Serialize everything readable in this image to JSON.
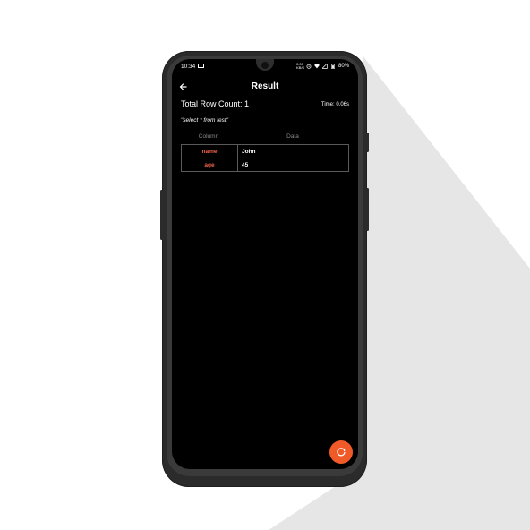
{
  "status_bar": {
    "time": "10:34",
    "speed_top": "0.00",
    "speed_bottom": "KB/S",
    "battery": "80%"
  },
  "header": {
    "title": "Result"
  },
  "summary": {
    "row_count": "Total Row Count: 1",
    "time": "Time: 0.06s",
    "query": "\"select * from test\""
  },
  "table": {
    "col_header": "Column",
    "data_header": "Data",
    "rows": [
      {
        "key": "name",
        "value": "John"
      },
      {
        "key": "age",
        "value": "45"
      }
    ]
  },
  "colors": {
    "accent": "#f05a28",
    "key_text": "#f0634a",
    "screen_bg": "#000000"
  },
  "icons": {
    "back": "arrow-left-icon",
    "refresh": "refresh-icon"
  }
}
